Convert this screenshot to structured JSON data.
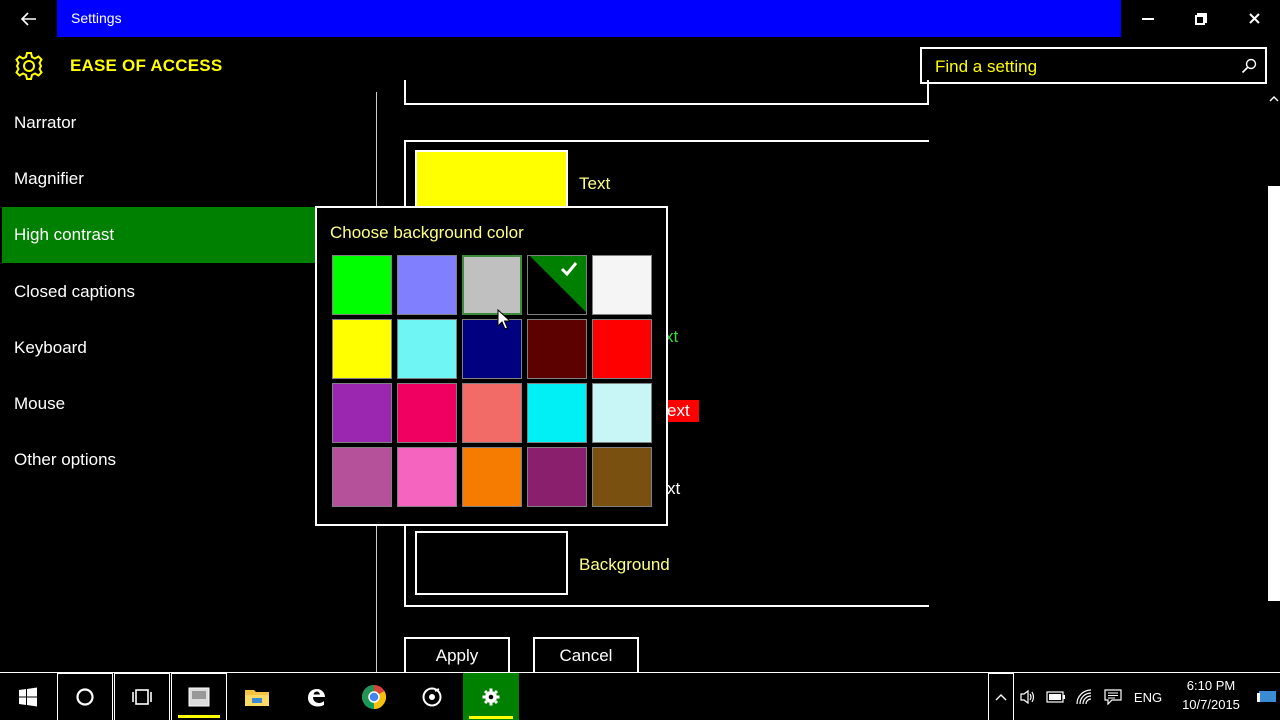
{
  "window": {
    "title": "Settings",
    "back_icon": "back-arrow-icon",
    "minimize_glyph": "—",
    "restore_glyph": "❐",
    "close_glyph": "✕"
  },
  "header": {
    "title": "EASE OF ACCESS",
    "icon": "gear-icon"
  },
  "search": {
    "placeholder": "Find a setting",
    "icon": "search-icon"
  },
  "sidebar": {
    "items": [
      {
        "label": "Narrator",
        "active": false
      },
      {
        "label": "Magnifier",
        "active": false
      },
      {
        "label": "High contrast",
        "active": true
      },
      {
        "label": "Closed captions",
        "active": false
      },
      {
        "label": "Keyboard",
        "active": false
      },
      {
        "label": "Mouse",
        "active": false
      },
      {
        "label": "Other options",
        "active": false
      }
    ]
  },
  "content": {
    "text_label": "Text",
    "hyperlink_label_visible": "xt",
    "selected_text_label_visible": "ext",
    "button_text_label_visible": "xt",
    "background_label": "Background",
    "text_color": "#ffff00",
    "background_color": "#000000",
    "apply_label": "Apply",
    "cancel_label": "Cancel"
  },
  "picker": {
    "title": "Choose background color",
    "colors": [
      "#00ff00",
      "#8080ff",
      "#c0c0c0",
      "#000000",
      "#f5f5f5",
      "#ffff00",
      "#70f5f5",
      "#000080",
      "#5c0000",
      "#ff0000",
      "#9b27b0",
      "#f00060",
      "#f26b66",
      "#00f0f5",
      "#c8f5f5",
      "#b5509b",
      "#f565c0",
      "#f57c00",
      "#8a1f6e",
      "#7a5010"
    ],
    "selected_index": 3,
    "hover_index": 2
  },
  "taskbar": {
    "items": [
      {
        "name": "start-icon"
      },
      {
        "name": "cortana-icon"
      },
      {
        "name": "task-view-icon"
      },
      {
        "name": "app-icon"
      },
      {
        "name": "file-explorer-icon"
      },
      {
        "name": "edge-icon"
      },
      {
        "name": "chrome-icon"
      },
      {
        "name": "media-icon"
      },
      {
        "name": "settings-icon"
      }
    ],
    "language": "ENG",
    "time": "6:10 PM",
    "date": "10/7/2015"
  }
}
